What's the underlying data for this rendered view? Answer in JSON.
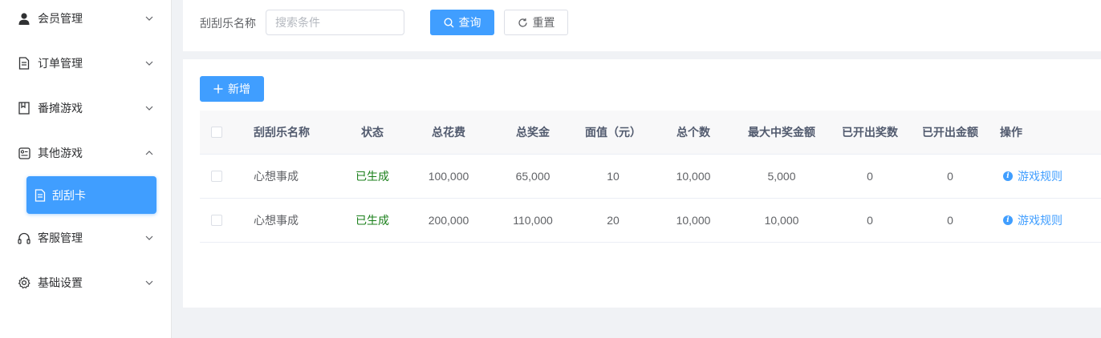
{
  "sidebar": {
    "items": [
      {
        "label": "会员管理",
        "icon": "user-icon"
      },
      {
        "label": "订单管理",
        "icon": "document-icon"
      },
      {
        "label": "番摊游戏",
        "icon": "bookmark-icon"
      },
      {
        "label": "其他游戏",
        "icon": "game-card-icon"
      },
      {
        "label": "客服管理",
        "icon": "headset-icon"
      },
      {
        "label": "基础设置",
        "icon": "gear-icon"
      }
    ],
    "active_sub": {
      "label": "刮刮卡",
      "icon": "document-icon"
    }
  },
  "search": {
    "label": "刮刮乐名称",
    "placeholder": "搜索条件",
    "value": "",
    "query_label": "查询",
    "reset_label": "重置"
  },
  "toolbar": {
    "add_label": "新增"
  },
  "table": {
    "headers": {
      "name": "刮刮乐名称",
      "status": "状态",
      "total_cost": "总花费",
      "total_prize": "总奖金",
      "face_value": "面值（元）",
      "total_count": "总个数",
      "max_prize": "最大中奖金额",
      "opened_count": "已开出奖数",
      "opened_amount": "已开出金额",
      "actions": "操作"
    },
    "rows": [
      {
        "name": "心想事成",
        "status": "已生成",
        "total_cost": "100,000",
        "total_prize": "65,000",
        "face_value": "10",
        "total_count": "10,000",
        "max_prize": "5,000",
        "opened_count": "0",
        "opened_amount": "0",
        "action": "游戏规则"
      },
      {
        "name": "心想事成",
        "status": "已生成",
        "total_cost": "200,000",
        "total_prize": "110,000",
        "face_value": "20",
        "total_count": "10,000",
        "max_prize": "10,000",
        "opened_count": "0",
        "opened_amount": "0",
        "action": "游戏规则"
      }
    ]
  },
  "colors": {
    "primary": "#409eff",
    "status_ok": "#1a7f1a",
    "background": "#f0f2f5"
  }
}
